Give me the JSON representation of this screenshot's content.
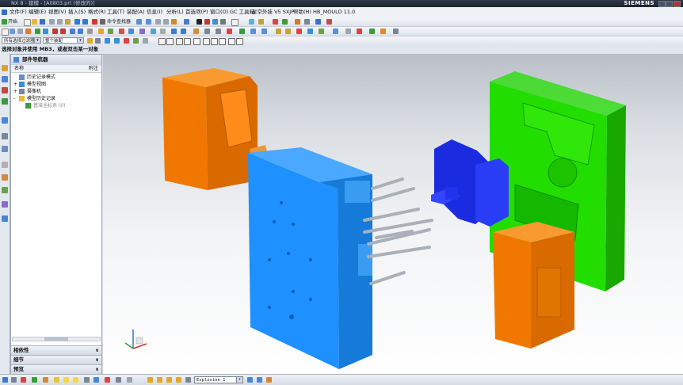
{
  "title_bar": {
    "title": "NX 8 - 建模 - [A0803.prt (修改的)]",
    "brand": "SIEMENS"
  },
  "menu": [
    "文件(F)",
    "编辑(E)",
    "视图(V)",
    "插入(S)",
    "格式(R)",
    "工具(T)",
    "装配(A)",
    "信息(I)",
    "分析(L)",
    "首选项(P)",
    "窗口(O)",
    "GC 工具箱",
    "星空外挂 V5 SXJP",
    "帮助(H)",
    "HB_MOULD 11.0"
  ],
  "toolbar1": {
    "start_label": "开始",
    "command_finder_label": "命令查找器"
  },
  "toolbar3": {
    "filter_select": "所有选择过滤器",
    "scope_select": "整个装配"
  },
  "cue_line": "选择对象并使用 MB3，或者双击某一对象",
  "navigator": {
    "title": "部件导航器",
    "col_name": "名称",
    "col_attach": "附注",
    "tree": [
      {
        "label": "历史记录模式",
        "indent": 0,
        "expand": "",
        "icon": "clock-icon"
      },
      {
        "label": "模型视图",
        "indent": 0,
        "expand": "+",
        "icon": "view-icon"
      },
      {
        "label": "摄像机",
        "indent": 0,
        "expand": "+",
        "icon": "camera-icon"
      },
      {
        "label": "模型历史记录",
        "indent": 0,
        "expand": "-",
        "icon": "folder-icon"
      },
      {
        "label": "基准坐标系 (0)",
        "indent": 1,
        "expand": "",
        "icon": "csys-icon"
      }
    ],
    "panels": [
      "相依性",
      "细节",
      "预览"
    ]
  },
  "bottom_bar": {
    "explosion_select": "Explosion 1"
  },
  "colors": {
    "title_bar": "#1f2836",
    "plate_blue": "#1e90ff",
    "plate_orange": "#f07800",
    "plate_green": "#22dd00",
    "insert_navy": "#1a2be0",
    "pins_gray": "#aab0b8"
  }
}
